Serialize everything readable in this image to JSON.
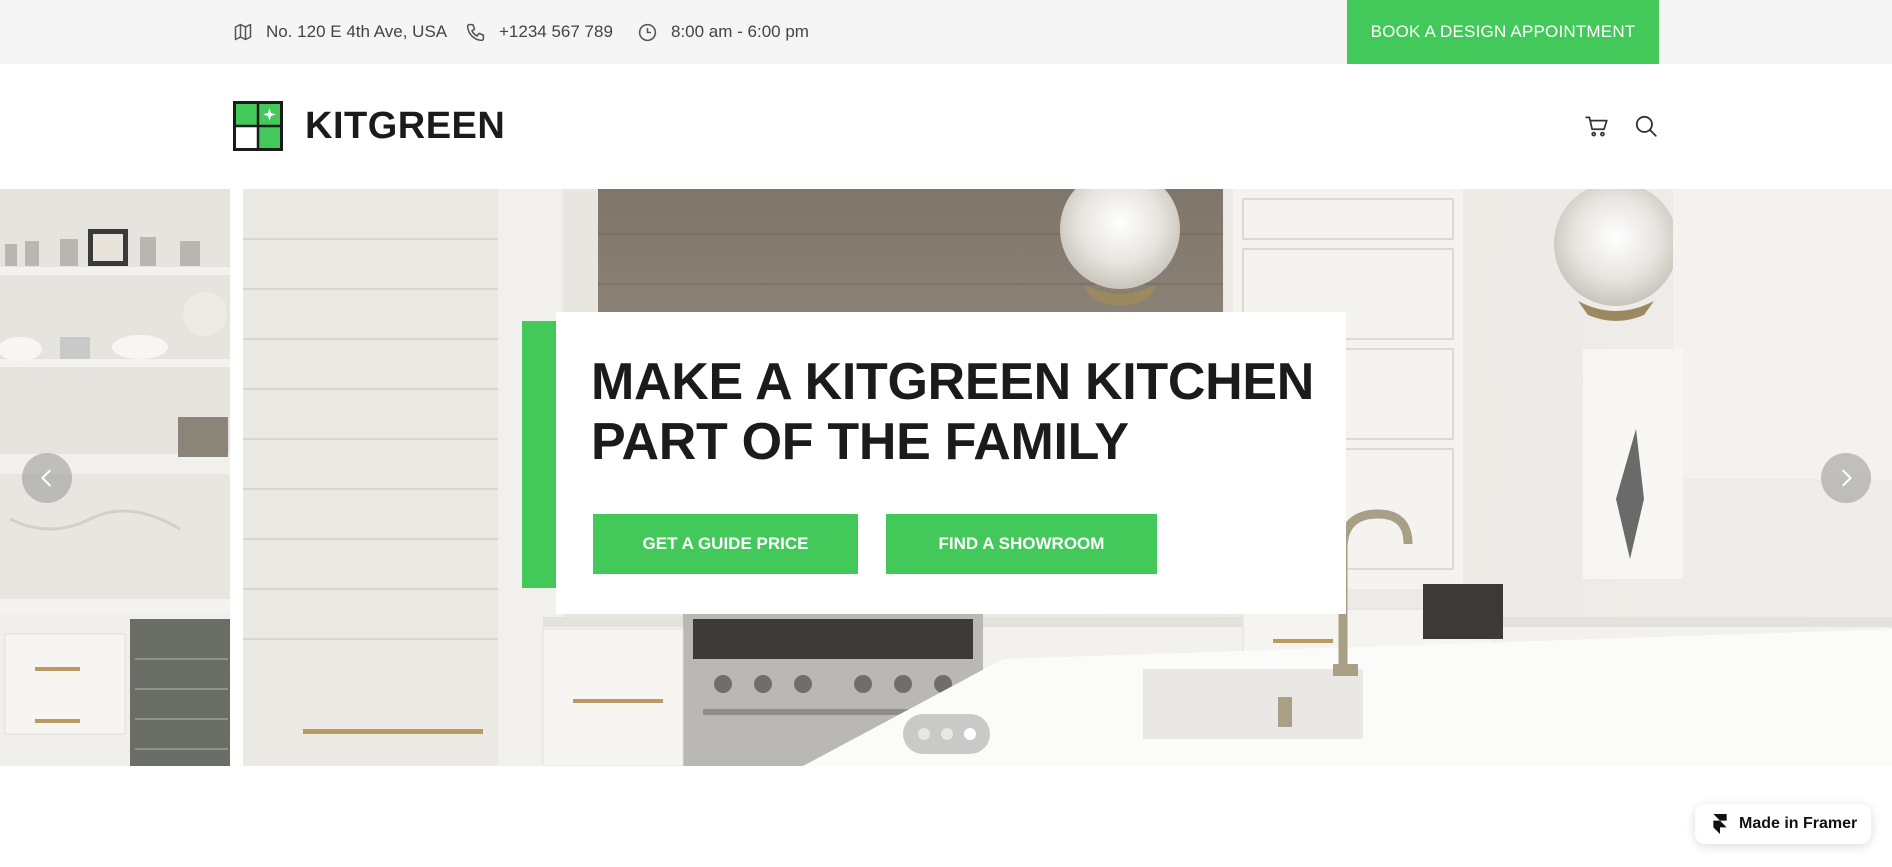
{
  "topbar": {
    "address": "No. 120 E 4th Ave, USA",
    "phone": "+1234 567 789",
    "hours": "8:00 am - 6:00 pm",
    "cta_label": "BOOK A DESIGN APPOINTMENT"
  },
  "header": {
    "logo_text": "KITGREEN",
    "icons": [
      "cart-icon",
      "search-icon"
    ]
  },
  "hero": {
    "title": "MAKE A KITGREEN KITCHEN PART OF THE FAMILY",
    "buttons": {
      "guide_price": "GET A GUIDE PRICE",
      "showroom": "FIND A SHOWROOM"
    },
    "slides_total": 3,
    "active_slide": 3
  },
  "badge": {
    "label": "Made in Framer"
  },
  "colors": {
    "accent": "#43c95a",
    "topbar_bg": "#f5f5f5",
    "text": "#1b1b1b"
  }
}
